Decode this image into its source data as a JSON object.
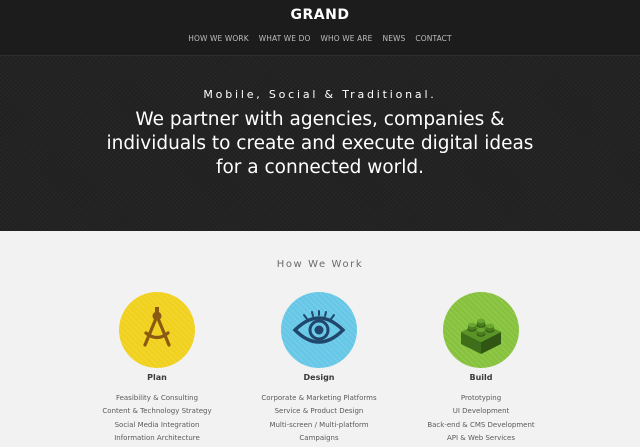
{
  "site": {
    "logo": "GRAND"
  },
  "nav": {
    "items": [
      "HOW WE WORK",
      "WHAT WE DO",
      "WHO WE ARE",
      "NEWS",
      "CONTACT"
    ]
  },
  "hero": {
    "tagline": "Mobile, Social & Traditional.",
    "lines": [
      "We partner with agencies, companies &",
      "individuals to create and execute digital ideas",
      "for a connected world."
    ]
  },
  "how_we_work": {
    "title": "How We Work",
    "columns": [
      {
        "title": "Plan",
        "icon": "compass-icon",
        "color": "#f0d11e",
        "items": [
          "Feasibility & Consulting",
          "Content & Technology Strategy",
          "Social Media Integration",
          "Information Architecture"
        ]
      },
      {
        "title": "Design",
        "icon": "eye-icon",
        "color": "#67c7e6",
        "items": [
          "Corporate & Marketing Platforms",
          "Service & Product Design",
          "Multi-screen / Multi-platform",
          "Campaigns"
        ]
      },
      {
        "title": "Build",
        "icon": "lego-brick-icon",
        "color": "#86c23c",
        "items": [
          "Prototyping",
          "UI Development",
          "Back-end & CMS Development",
          "API & Web Services"
        ]
      }
    ]
  }
}
